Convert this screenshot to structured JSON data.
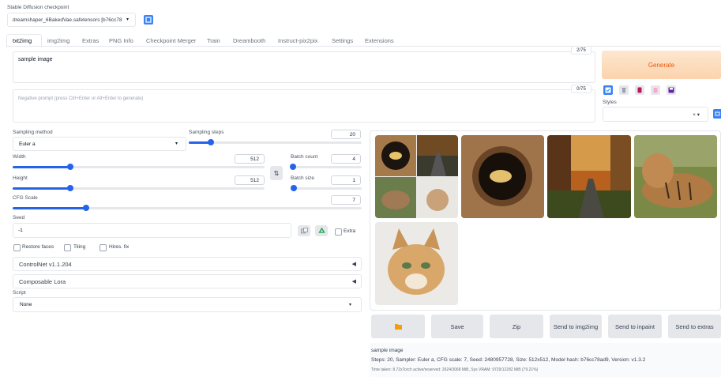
{
  "checkpoint": {
    "label": "Stable Diffusion checkpoint",
    "value": "dreamshaper_6BakedVae.safetensors [b76cc78"
  },
  "tabs": [
    "txt2img",
    "img2img",
    "Extras",
    "PNG Info",
    "Checkpoint Merger",
    "Train",
    "Dreambooth",
    "Instruct-pix2pix",
    "Settings",
    "Extensions"
  ],
  "prompt": {
    "value": "sample image",
    "counter": "2/75"
  },
  "negative_prompt": {
    "placeholder": "Negative prompt (press Ctrl+Enter or Alt+Enter to generate)",
    "counter": "0/75"
  },
  "generate_label": "Generate",
  "styles_label": "Styles",
  "styles_clear": "× ▾",
  "sampling_method": {
    "label": "Sampling method",
    "value": "Euler a"
  },
  "sampling_steps": {
    "label": "Sampling steps",
    "value": "20",
    "fraction": 0.13
  },
  "width": {
    "label": "Width",
    "value": "512",
    "fraction": 0.23
  },
  "height": {
    "label": "Height",
    "value": "512",
    "fraction": 0.23
  },
  "batch_count": {
    "label": "Batch count",
    "value": "4",
    "fraction": 0.03
  },
  "batch_size": {
    "label": "Batch size",
    "value": "1",
    "fraction": 0.0
  },
  "cfg_scale": {
    "label": "CFG Scale",
    "value": "7",
    "fraction": 0.21
  },
  "seed": {
    "label": "Seed",
    "value": "-1"
  },
  "extra_label": "Extra",
  "checkboxes": [
    "Restore faces",
    "Tiling",
    "Hires. fix"
  ],
  "accordions": [
    "ControlNet v1.1.204",
    "Composable Lora"
  ],
  "script": {
    "label": "Script",
    "value": "None"
  },
  "swap_icon": "⇅",
  "output_buttons": [
    "Save",
    "Zip",
    "Send to img2img",
    "Send to inpaint",
    "Send to extras"
  ],
  "output_info": {
    "prompt": "sample image",
    "params": "Steps: 20, Sampler: Euler a, CFG scale: 7, Seed: 2480957728, Size: 512x512, Model hash: b76cc78ad9, Version: v1.3.2",
    "time": "Time taken: 8.72sTorch active/reserved: 2624/3068 MiB, Sys VRAM: 9729/12282 MiB (79.21%)"
  },
  "colors": {
    "accent": "#2563eb",
    "generate_bg": "#fcd9b8",
    "generate_text": "#ea580c"
  }
}
